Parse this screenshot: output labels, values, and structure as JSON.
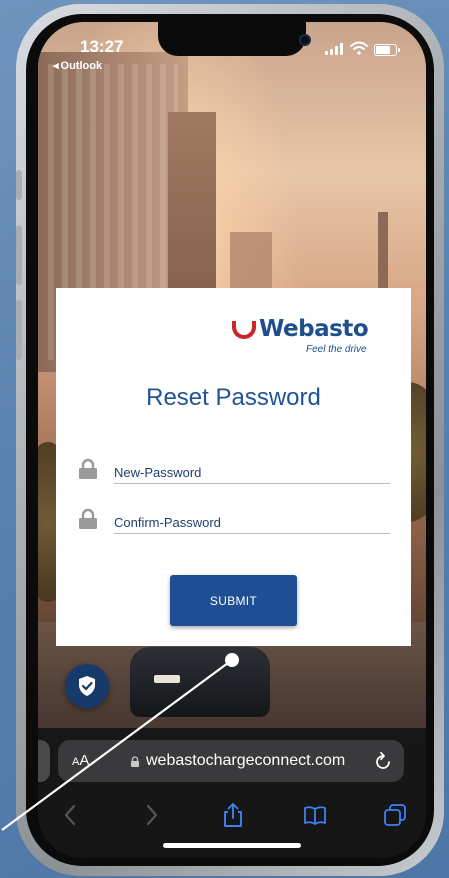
{
  "status_bar": {
    "time": "13:27",
    "back_app": "Outlook",
    "back_caret": "◂"
  },
  "card": {
    "logo": {
      "brand_text": "Webasto",
      "tagline": "Feel the drive",
      "brand_color": "#1d4f8f",
      "accent_color": "#c8262b"
    },
    "title": "Reset Password",
    "fields": [
      {
        "placeholder": "New-Password",
        "icon": "lock-icon"
      },
      {
        "placeholder": "Confirm-Password",
        "icon": "lock-icon"
      }
    ],
    "submit_label": "SUBMIT",
    "button_color": "#1e4f95"
  },
  "floating": {
    "icon": "shield-check-icon",
    "color": "#183a6a"
  },
  "browser": {
    "aa_label_small": "A",
    "aa_label_large": "A",
    "url": "webastochargeconnect.com",
    "toolbar_icons": [
      "back-icon",
      "forward-icon",
      "share-icon",
      "bookmarks-icon",
      "tabs-icon"
    ]
  }
}
